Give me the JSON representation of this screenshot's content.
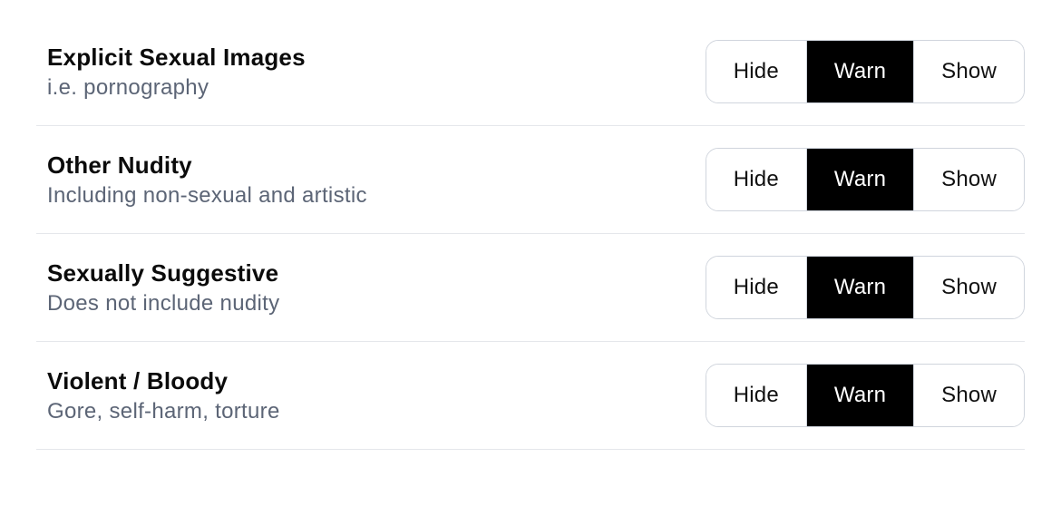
{
  "options": {
    "hide": "Hide",
    "warn": "Warn",
    "show": "Show"
  },
  "settings": [
    {
      "title": "Explicit Sexual Images",
      "desc": "i.e. pornography",
      "selected": "warn"
    },
    {
      "title": "Other Nudity",
      "desc": "Including non-sexual and artistic",
      "selected": "warn"
    },
    {
      "title": "Sexually Suggestive",
      "desc": "Does not include nudity",
      "selected": "warn"
    },
    {
      "title": "Violent / Bloody",
      "desc": "Gore, self-harm, torture",
      "selected": "warn"
    }
  ]
}
